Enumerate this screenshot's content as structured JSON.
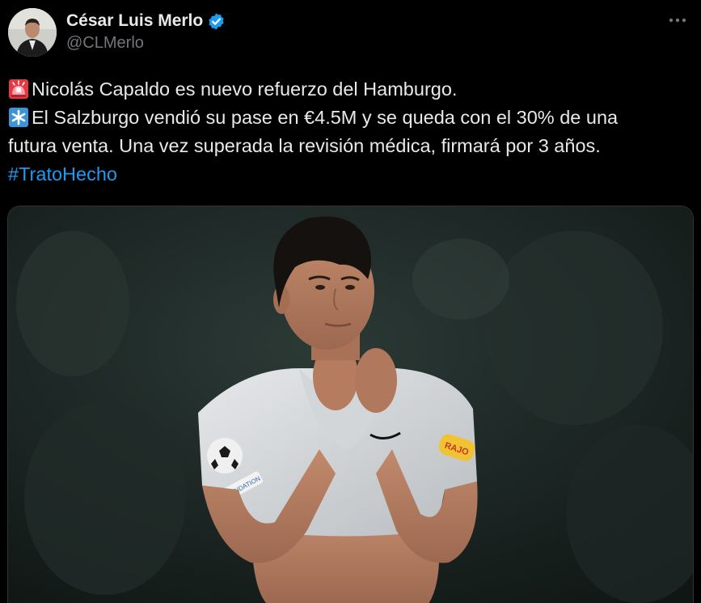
{
  "author": {
    "display_name": "César Luis Merlo",
    "handle": "@CLMerlo",
    "verified": true
  },
  "tweet": {
    "lines": [
      {
        "emoji": "rotating-light-icon",
        "text": "Nicolás Capaldo es nuevo refuerzo del Hamburgo."
      },
      {
        "emoji": "asterisk-icon",
        "text": "El Salzburgo vendió su pase en €4.5M y se queda con el 30% de una"
      },
      {
        "emoji": "",
        "text": "futura venta. Una vez superada la revisión médica, firmará por 3 años."
      }
    ],
    "hashtag": "#TratoHecho"
  },
  "media": {
    "badge_text": "RAJO",
    "sleeve_text": "FOUNDATION"
  },
  "colors": {
    "background": "#000000",
    "text": "#e7e9ea",
    "secondary": "#71767b",
    "link": "#1d9bf0",
    "verified": "#1d9bf0"
  }
}
